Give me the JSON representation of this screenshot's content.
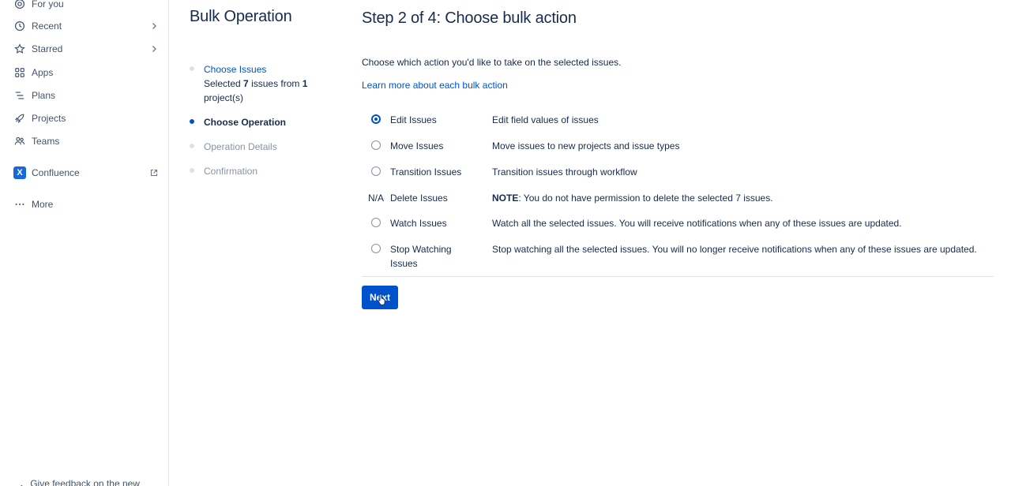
{
  "sidebar": {
    "items": [
      {
        "label": "For you",
        "icon": "target-icon",
        "chevron": false
      },
      {
        "label": "Recent",
        "icon": "clock-icon",
        "chevron": true
      },
      {
        "label": "Starred",
        "icon": "star-icon",
        "chevron": true
      },
      {
        "label": "Apps",
        "icon": "apps-icon",
        "chevron": false
      },
      {
        "label": "Plans",
        "icon": "plans-icon",
        "chevron": false
      },
      {
        "label": "Projects",
        "icon": "rocket-icon",
        "chevron": false
      },
      {
        "label": "Teams",
        "icon": "teams-icon",
        "chevron": false
      }
    ],
    "confluence": {
      "label": "Confluence",
      "logo_letter": "X",
      "icon": "external-link-icon"
    },
    "more": {
      "label": "More",
      "icon": "more-icon"
    },
    "bottom": {
      "label": "Give feedback on the new navigation"
    }
  },
  "steps": {
    "title": "Bulk Operation",
    "choose_issues": {
      "label": "Choose Issues",
      "sub_prefix": "Selected ",
      "issue_count": "7",
      "sub_middle": " issues from ",
      "project_count": "1",
      "sub_suffix": "project(s)"
    },
    "choose_operation": "Choose Operation",
    "operation_details": "Operation Details",
    "confirmation": "Confirmation"
  },
  "main": {
    "title": "Step 2 of 4: Choose bulk action",
    "intro": "Choose which action you'd like to take on the selected issues.",
    "learn_link": "Learn more about each bulk action",
    "options": [
      {
        "name": "Edit Issues",
        "desc": "Edit field values of issues",
        "checked": true
      },
      {
        "name": "Move Issues",
        "desc": "Move issues to new projects and issue types"
      },
      {
        "name": "Transition Issues",
        "desc": "Transition issues through workflow"
      },
      {
        "na": "N/A",
        "name": "Delete Issues",
        "note_label": "NOTE",
        "desc": ": You do not have permission to delete the selected 7 issues."
      },
      {
        "name": "Watch Issues",
        "desc": "Watch all the selected issues. You will receive notifications when any of these issues are updated."
      },
      {
        "name": "Stop Watching Issues",
        "desc": "Stop watching all the selected issues. You will no longer receive notifications when any of these issues are updated."
      }
    ],
    "next_label": "Next"
  },
  "colors": {
    "primary": "#0052cc",
    "text": "#172b4d",
    "muted": "#8993a4",
    "confluence": "#1868db"
  }
}
